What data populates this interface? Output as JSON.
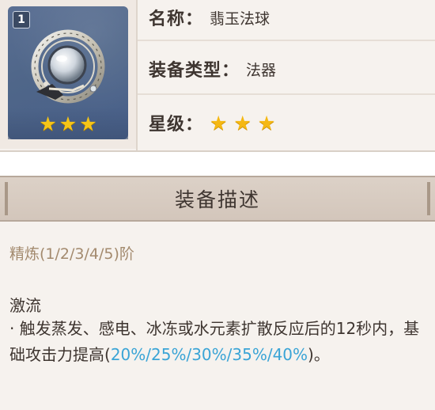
{
  "item": {
    "rank_badge": "1",
    "thumb_stars": [
      "★",
      "★",
      "★"
    ],
    "icon": "jade-orb-catalyst-icon",
    "name_label": "名称：",
    "name_value": "翡玉法球",
    "type_label": "装备类型：",
    "type_value": "法器",
    "rarity_label": "星级：",
    "rarity_stars": [
      "★",
      "★",
      "★"
    ],
    "rarity_count": 3
  },
  "description": {
    "header": "装备描述",
    "refinement": "精炼(1/2/3/4/5)阶",
    "effect_name": "激流",
    "effect_prefix": "· 触发蒸发、感电、冰冻或水元素扩散反应后的12秒内，基础攻击力提高(",
    "effect_values": "20%/25%/30%/35%/40%",
    "effect_suffix": ")。"
  },
  "colors": {
    "highlight": "#3aa4d6",
    "star": "#f5b813",
    "refine_text": "#a38a6e",
    "panel_bg": "#f6f2ee",
    "header_bg": "#d3c6bb"
  }
}
